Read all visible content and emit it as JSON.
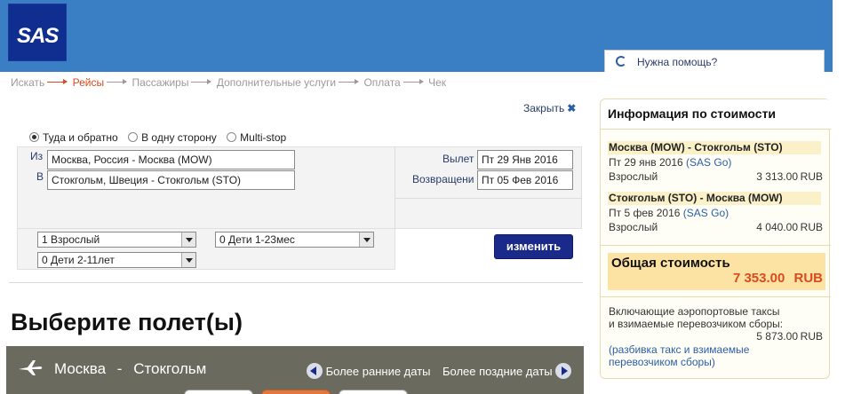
{
  "header": {
    "logo_text": "SAS",
    "help_label": "Нужна помощь?",
    "brand_color": "#3a7ec4",
    "logo_color": "#0f2e8f"
  },
  "steps": [
    {
      "label": "Искать",
      "active": false
    },
    {
      "label": "Рейсы",
      "active": true
    },
    {
      "label": "Пассажиры",
      "active": false
    },
    {
      "label": "Дополнительные услуги",
      "active": false
    },
    {
      "label": "Оплата",
      "active": false
    },
    {
      "label": "Чек",
      "active": false
    }
  ],
  "search": {
    "close_label": "Закрыть",
    "trip_types": [
      {
        "label": "Туда и обратно",
        "selected": true
      },
      {
        "label": "В одну сторону",
        "selected": false
      },
      {
        "label": "Multi-stop",
        "selected": false
      }
    ],
    "from_label": "Из",
    "from_value": "Москва, Россия - Москва (MOW)",
    "to_label": "В",
    "to_value": "Стокгольм, Швеция - Стокгольм (STO)",
    "depart_label": "Вылет",
    "depart_value": "Пт 29 Янв 2016",
    "return_label": "Возвращени",
    "return_value": "Пт 05 Фев 2016",
    "adults": "1 Взрослый",
    "infants": "0 Дети 1-23мес",
    "children": "0 Дети 2-11лет",
    "change_button": "изменить"
  },
  "main": {
    "heading": "Выберите полет(ы)",
    "route_from": "Москва",
    "route_dash": "-",
    "route_to": "Стокгольм",
    "earlier_dates": "Более ранние даты",
    "later_dates": "Более поздние даты"
  },
  "price_info": {
    "title": "Информация по стоимости",
    "segments": [
      {
        "route": "Москва (MOW) - Стокгольм (STO)",
        "date": "Пт 29 янв 2016",
        "fare": "(SAS Go)",
        "pax": "Взрослый",
        "amount": "3 313.00",
        "currency": "RUB"
      },
      {
        "route": "Стокгольм (STO) - Москва (MOW)",
        "date": "Пт 5 фев 2016",
        "fare": "(SAS Go)",
        "pax": "Взрослый",
        "amount": "4 040.00",
        "currency": "RUB"
      }
    ],
    "total_label": "Общая стоимость",
    "total_value": "7 353.00",
    "total_currency": "RUB",
    "taxes_line1": "Включающие аэропортовые таксы",
    "taxes_line2": "и взимаемые перевозчиком сборы:",
    "taxes_amount": "5 873.00",
    "taxes_currency": "RUB",
    "breakdown_line1": "(разбивка такс и взимаемые",
    "breakdown_line2": "перевозчиком сборы)"
  }
}
